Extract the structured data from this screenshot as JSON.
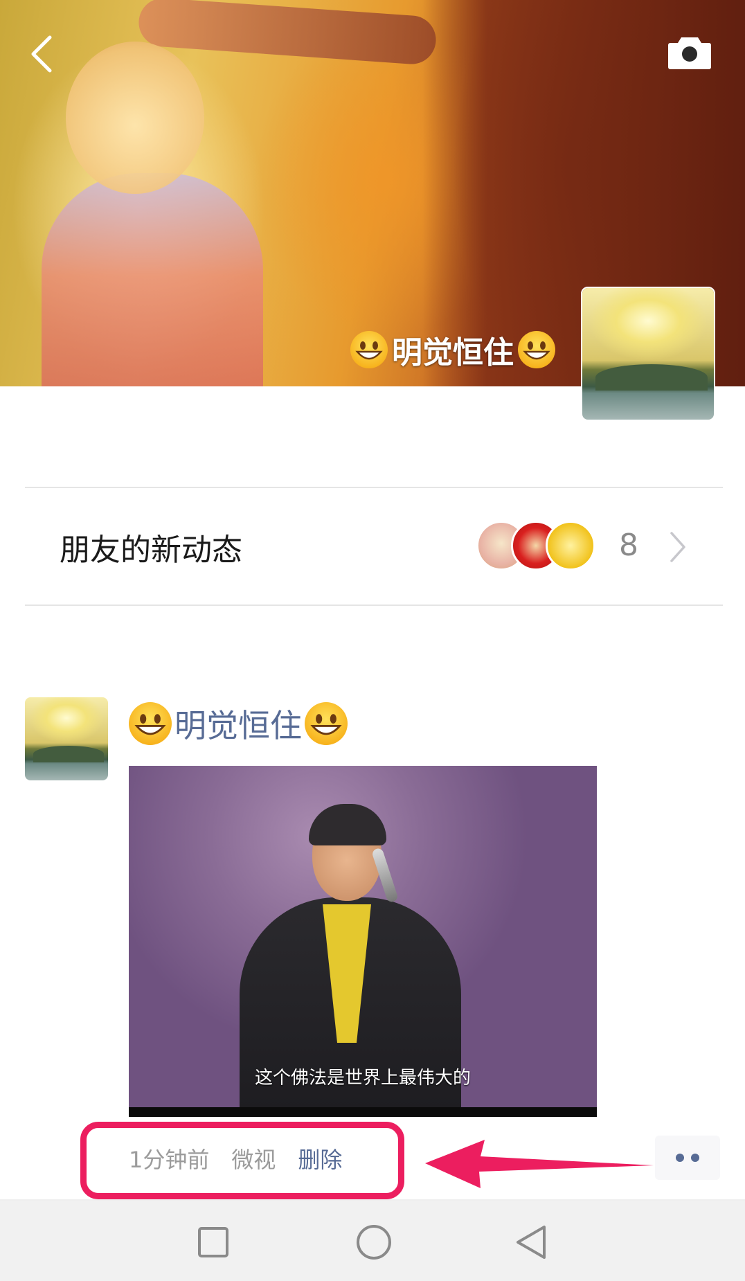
{
  "cover": {
    "display_name": "明觉恒住",
    "name_emoji": "grinning-face-emoji"
  },
  "header": {
    "back_icon": "chevron-left-icon",
    "camera_icon": "camera-icon"
  },
  "friends_updates": {
    "title": "朋友的新动态",
    "count": "8",
    "chevron_icon": "chevron-right-icon"
  },
  "post": {
    "author": "明觉恒住",
    "video_subtitle": "这个佛法是世界上最伟大的",
    "time": "1分钟前",
    "source": "微视",
    "delete_label": "删除",
    "more_icon": "more-dots-icon"
  },
  "annotation": {
    "box_color": "#ec1e5f",
    "arrow_color": "#ec1e5f"
  },
  "navbar": {
    "recent_icon": "square-icon",
    "home_icon": "circle-icon",
    "back_icon": "triangle-back-icon"
  },
  "colors": {
    "link_blue": "#576b95",
    "meta_gray": "#9b9b9b",
    "divider": "#e5e5e5"
  }
}
